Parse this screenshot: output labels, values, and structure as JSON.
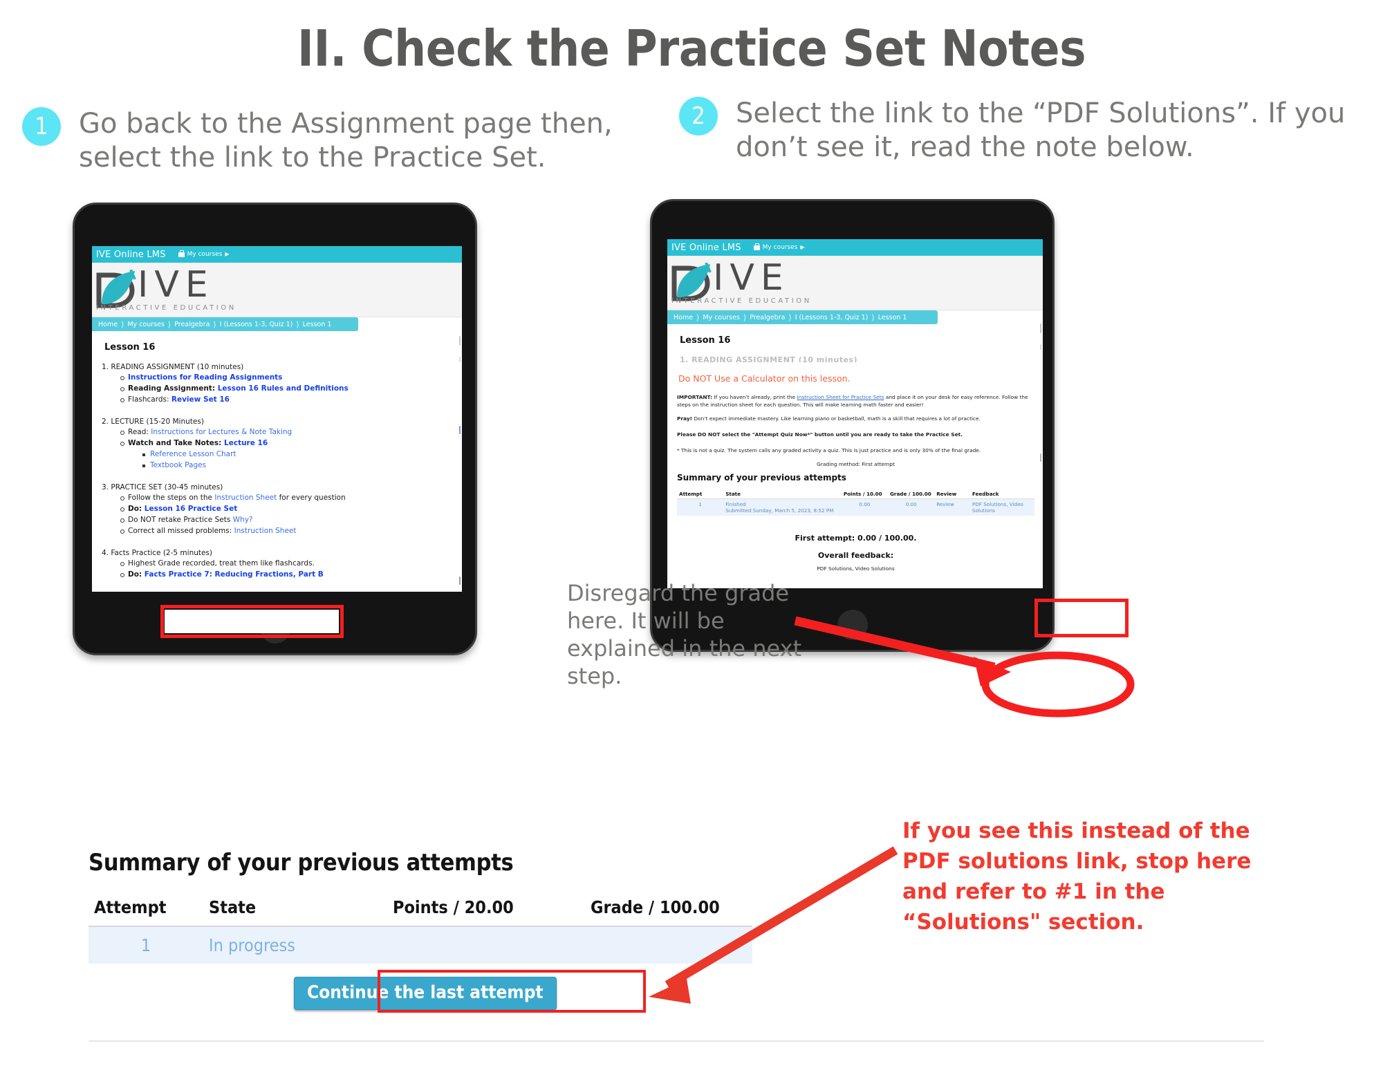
{
  "title": "II. Check the Practice Set Notes",
  "steps": [
    {
      "number": "1",
      "text": "Go back to the Assignment page then, select the link to the Practice Set."
    },
    {
      "number": "2",
      "text": "Select the link to the “PDF Solutions”. If you don’t see it, read the  note below."
    }
  ],
  "annotations": {
    "disregard_note": "Disregard the grade here. It will be explained in the next step.",
    "stop_note": "If you see this instead of the PDF solutions link, stop here and refer to #1 in the “Solutions\" section."
  },
  "lms": {
    "brand": "IVE Online LMS",
    "my_courses": "My courses",
    "logo_letters": "IVE",
    "logo_tagline": "INTERACTIVE EDUCATION",
    "breadcrumb": [
      "Home",
      "My courses",
      "Prealgebra",
      "I (Lessons 1-3, Quiz 1)",
      "Lesson 1"
    ]
  },
  "left_screen": {
    "lesson_title": "Lesson 16",
    "sections": [
      {
        "heading": "1. READING ASSIGNMENT (10 minutes)",
        "items": [
          {
            "bold_prefix": "",
            "link": "Instructions for Reading Assignments",
            "link_bold": true,
            "tail": ""
          },
          {
            "bold_prefix": "Reading Assignment: ",
            "link": "Lesson 16 Rules and Definitions",
            "link_bold": true,
            "tail": ""
          },
          {
            "bold_prefix": "Flashcards: ",
            "prefix_bold": false,
            "link": "Review Set 16",
            "link_bold": true,
            "tail": ""
          }
        ]
      },
      {
        "heading": "2. LECTURE (15-20 Minutes)",
        "items": [
          {
            "bold_prefix": "Read: ",
            "prefix_bold": false,
            "link": "Instructions for Lectures & Note Taking",
            "link_bold": false,
            "tail": ""
          },
          {
            "bold_prefix": "Watch and Take Notes: ",
            "prefix_bold": true,
            "link": "Lecture 16",
            "link_bold": true,
            "tail": ""
          }
        ],
        "subitems": [
          "Reference Lesson Chart",
          "Textbook Pages"
        ]
      },
      {
        "heading": "3. PRACTICE SET (30-45 minutes)",
        "items": [
          {
            "bold_prefix": "Follow the steps on the ",
            "prefix_bold": false,
            "link": "Instruction Sheet",
            "link_bold": false,
            "tail": " for every question"
          },
          {
            "bold_prefix": "Do: ",
            "prefix_bold": true,
            "link": "Lesson 16 Practice Set",
            "link_bold": true,
            "tail": "",
            "highlighted": true
          },
          {
            "bold_prefix": "Do NOT retake Practice Sets ",
            "prefix_bold": false,
            "link": "Why?",
            "link_bold": false,
            "tail": ""
          },
          {
            "bold_prefix": "Correct all missed problems: ",
            "prefix_bold": false,
            "link": "Instruction Sheet",
            "link_bold": false,
            "tail": ""
          }
        ]
      },
      {
        "heading": "4. Facts Practice (2-5 minutes)",
        "items": [
          {
            "bold_prefix": "Highest Grade recorded, treat them like flashcards.",
            "prefix_bold": false,
            "link": "",
            "link_bold": false,
            "tail": ""
          },
          {
            "bold_prefix": "Do: ",
            "prefix_bold": true,
            "link": "Facts Practice 7: Reducing Fractions, Part B",
            "link_bold": true,
            "tail": ""
          }
        ]
      }
    ]
  },
  "right_screen": {
    "lesson_title": "Lesson 16",
    "ghost_heading": "1. READING ASSIGNMENT (10 minutes)",
    "calculator_note": "Do NOT Use a Calculator on this lesson.",
    "important_label": "IMPORTANT:",
    "important_text_1": " If you haven’t already, print the ",
    "important_link": "Instruction Sheet for Practice Sets",
    "important_text_2": " and place it on your desk for easy reference. Follow the steps on the instruction sheet for each question. This will make learning math faster and easier!",
    "pray_label": "Pray!",
    "pray_text": " Don’t expect immediate mastery. Like learning piano or basketball, math is a skill that requires a lot of practice.",
    "attempt_warning": "Please DO NOT select the \"Attempt Quiz Now*\" button until you are ready to take the Practice Set.",
    "footnote": "* This is not a quiz. The system calls any graded activity a quiz. This is just practice and is only 30% of the final grade.",
    "grading_method": "Grading method: First attempt",
    "summary_heading": "Summary of your previous attempts",
    "table": {
      "headers": [
        "Attempt",
        "State",
        "Points / 10.00",
        "Grade / 100.00",
        "Review",
        "Feedback"
      ],
      "rows": [
        {
          "attempt": "1",
          "state": "Finished",
          "state_sub": "Submitted Sunday, March 5, 2023, 8:52 PM",
          "points": "0.00",
          "grade": "0.00",
          "review": "Review",
          "feedback": "PDF Solutions, Video Solutions"
        }
      ]
    },
    "first_attempt": "First attempt: 0.00 / 100.00.",
    "overall_feedback": "Overall feedback:",
    "feedback_center": "PDF Solutions, Video Solutions"
  },
  "bottom_block": {
    "heading": "Summary of your previous attempts",
    "headers": [
      "Attempt",
      "State",
      "Points / 20.00",
      "Grade / 100.00"
    ],
    "rows": [
      {
        "attempt": "1",
        "state": "In progress",
        "points": "",
        "grade": ""
      }
    ],
    "continue_button": "Continue the last attempt"
  },
  "colors": {
    "accent_cyan": "#5ce6f5",
    "nav_teal": "#2bbfd3",
    "breadcrumb_teal": "#54cbdd",
    "alert_red": "#f23b30",
    "highlight_red": "#f42020",
    "link_blue": "#1741e8",
    "orange": "#f4613c",
    "button_blue": "#3aa8cc",
    "title_gray": "#5a5a58"
  }
}
